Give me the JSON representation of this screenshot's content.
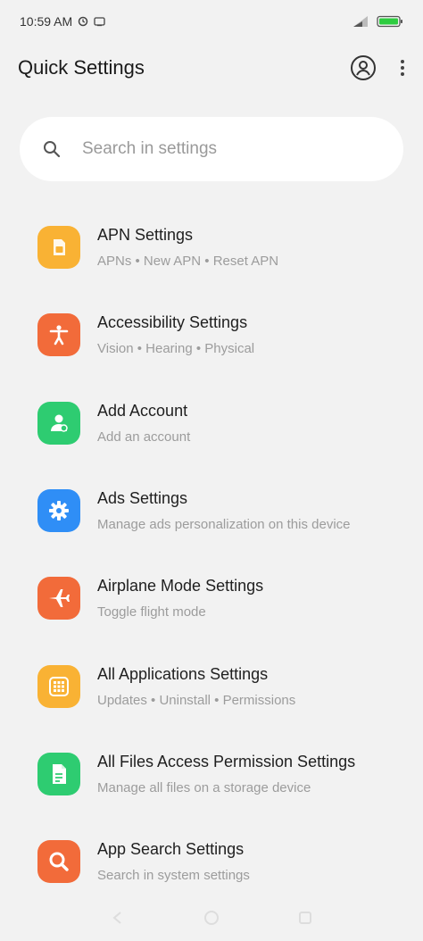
{
  "status": {
    "time": "10:59 AM"
  },
  "header": {
    "title": "Quick Settings"
  },
  "search": {
    "placeholder": "Search in settings"
  },
  "items": [
    {
      "title": "APN Settings",
      "subtitle": "APNs • New APN • Reset APN",
      "color": "#f9b234",
      "icon": "sim-card-icon"
    },
    {
      "title": "Accessibility Settings",
      "subtitle": "Vision • Hearing • Physical",
      "color": "#f26b3a",
      "icon": "accessibility-icon"
    },
    {
      "title": "Add Account",
      "subtitle": "Add an account",
      "color": "#2ecc71",
      "icon": "add-person-icon"
    },
    {
      "title": "Ads Settings",
      "subtitle": "Manage ads personalization on this device",
      "color": "#2f8ef6",
      "icon": "gear-icon"
    },
    {
      "title": "Airplane Mode Settings",
      "subtitle": "Toggle flight mode",
      "color": "#f26b3a",
      "icon": "airplane-icon"
    },
    {
      "title": "All Applications Settings",
      "subtitle": "Updates • Uninstall • Permissions",
      "color": "#f9b234",
      "icon": "apps-grid-icon"
    },
    {
      "title": "All Files Access Permission Settings",
      "subtitle": "Manage all files on a storage device",
      "color": "#2ecc71",
      "icon": "file-icon"
    },
    {
      "title": "App Search Settings",
      "subtitle": "Search in system settings",
      "color": "#f26b3a",
      "icon": "search-icon"
    }
  ]
}
